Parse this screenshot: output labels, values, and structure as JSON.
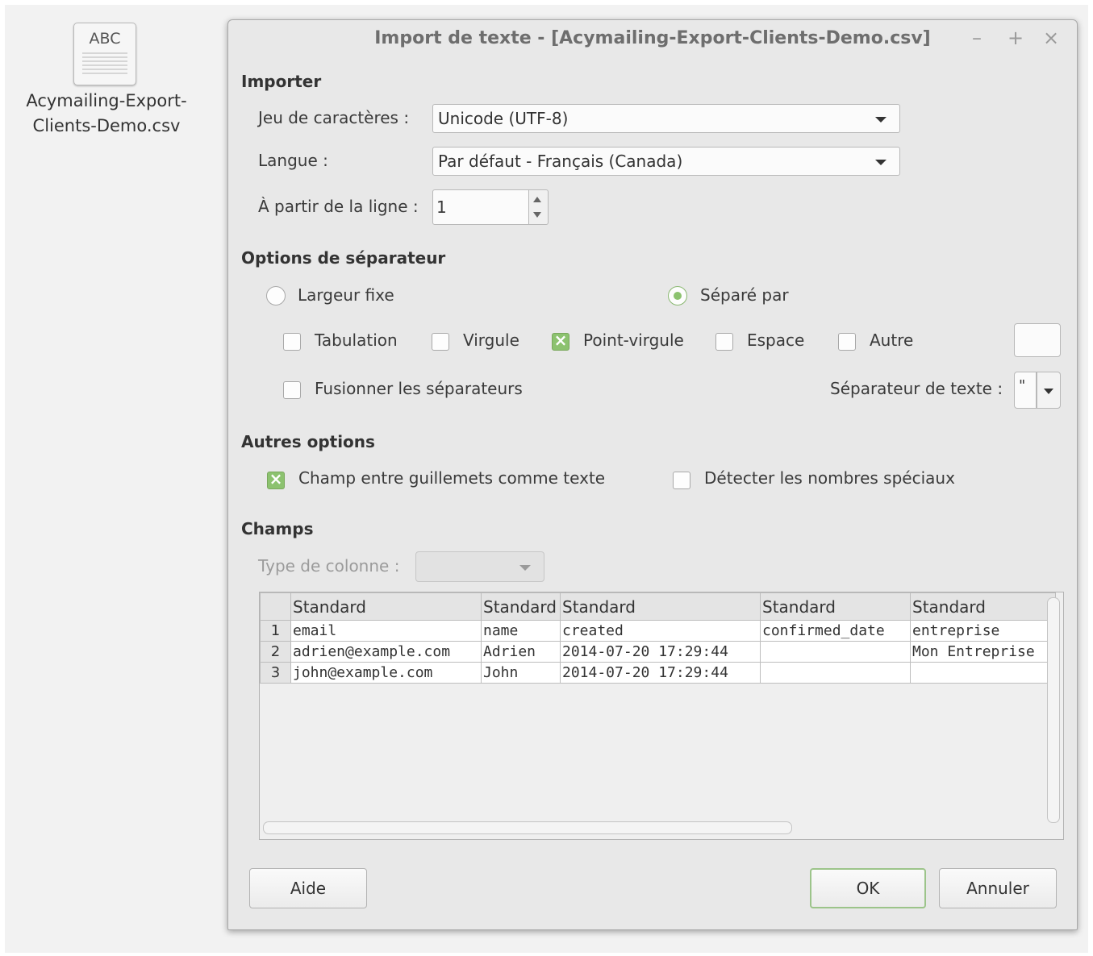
{
  "desktop": {
    "file_icon_text": "ABC",
    "file_name_line1": "Acymailing-Export-",
    "file_name_line2": "Clients-Demo.csv"
  },
  "dialog": {
    "title": "Import de texte - [Acymailing-Export-Clients-Demo.csv]",
    "window_buttons": {
      "minimize": "–",
      "maximize": "+",
      "close": "×"
    },
    "importer": {
      "heading": "Importer",
      "charset_label": "Jeu de caractères :",
      "charset_value": "Unicode (UTF-8)",
      "language_label": "Langue :",
      "language_value": "Par défaut - Français (Canada)",
      "from_line_label": "À partir de la ligne :",
      "from_line_value": "1"
    },
    "separator": {
      "heading": "Options de séparateur",
      "fixed_width": {
        "label": "Largeur fixe",
        "selected": false
      },
      "separated_by": {
        "label": "Séparé par",
        "selected": true
      },
      "tab": {
        "label": "Tabulation",
        "checked": false
      },
      "comma": {
        "label": "Virgule",
        "checked": false
      },
      "semicolon": {
        "label": "Point-virgule",
        "checked": true
      },
      "space": {
        "label": "Espace",
        "checked": false
      },
      "other": {
        "label": "Autre",
        "checked": false
      },
      "merge": {
        "label": "Fusionner les séparateurs",
        "checked": false
      },
      "text_delimiter_label": "Séparateur de texte :",
      "text_delimiter_value": "\""
    },
    "other_options": {
      "heading": "Autres options",
      "quoted_as_text": {
        "label": "Champ entre guillemets comme texte",
        "checked": true
      },
      "detect_special_numbers": {
        "label": "Détecter les nombres spéciaux",
        "checked": false
      }
    },
    "fields": {
      "heading": "Champs",
      "column_type_label": "Type de colonne :",
      "column_type_value": "",
      "columns": [
        "Standard",
        "Standard",
        "Standard",
        "Standard",
        "Standard"
      ],
      "rows": [
        {
          "num": "1",
          "cells": [
            "email",
            "name",
            "created",
            "confirmed_date",
            "entreprise"
          ]
        },
        {
          "num": "2",
          "cells": [
            "adrien@example.com",
            "Adrien",
            "2014-07-20 17:29:44",
            "",
            "Mon Entreprise"
          ]
        },
        {
          "num": "3",
          "cells": [
            "john@example.com",
            "John",
            "2014-07-20 17:29:44",
            "",
            ""
          ]
        }
      ]
    },
    "buttons": {
      "help": "Aide",
      "ok": "OK",
      "cancel": "Annuler"
    }
  }
}
